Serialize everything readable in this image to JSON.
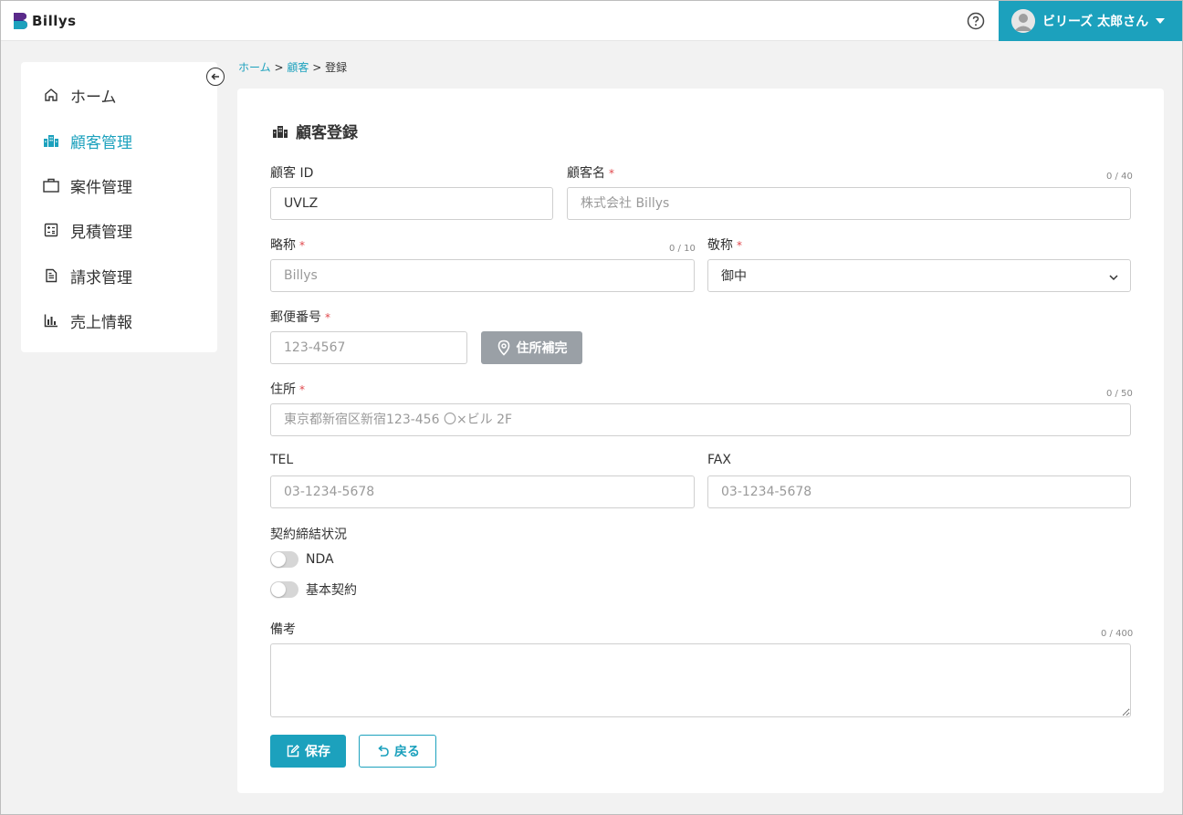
{
  "app": {
    "logo_text": "Billys"
  },
  "header": {
    "user_name": "ビリーズ 太郎さん"
  },
  "sidebar": {
    "items": [
      {
        "label": "ホーム",
        "icon": "home-icon"
      },
      {
        "label": "顧客管理",
        "icon": "building-icon",
        "active": true
      },
      {
        "label": "案件管理",
        "icon": "briefcase-icon"
      },
      {
        "label": "見積管理",
        "icon": "calculator-icon"
      },
      {
        "label": "請求管理",
        "icon": "document-icon"
      },
      {
        "label": "売上情報",
        "icon": "bar-chart-icon"
      }
    ]
  },
  "breadcrumb": {
    "home": "ホーム",
    "customer": "顧客",
    "current": "登録",
    "sep": ">"
  },
  "form": {
    "title": "顧客登録",
    "required_mark": "*",
    "customer_id": {
      "label": "顧客 ID",
      "value": "UVLZ"
    },
    "customer_name": {
      "label": "顧客名",
      "placeholder": "株式会社 Billys",
      "counter": "0 / 40"
    },
    "short_name": {
      "label": "略称",
      "placeholder": "Billys",
      "counter": "0 / 10"
    },
    "honorific": {
      "label": "敬称",
      "value": "御中"
    },
    "postal_code": {
      "label": "郵便番号",
      "placeholder": "123-4567"
    },
    "address_button": "住所補完",
    "address": {
      "label": "住所",
      "placeholder": "東京都新宿区新宿123-456 〇×ビル 2F",
      "counter": "0 / 50"
    },
    "tel": {
      "label": "TEL",
      "placeholder": "03-1234-5678"
    },
    "fax": {
      "label": "FAX",
      "placeholder": "03-1234-5678"
    },
    "contract_status": {
      "label": "契約締結状況",
      "nda": "NDA",
      "basic": "基本契約"
    },
    "notes": {
      "label": "備考",
      "counter": "0 / 400"
    },
    "save_label": "保存",
    "back_label": "戻る"
  },
  "colors": {
    "accent": "#1ca1bd",
    "required": "#e0474c",
    "disabled_button": "#9aa0a6"
  }
}
